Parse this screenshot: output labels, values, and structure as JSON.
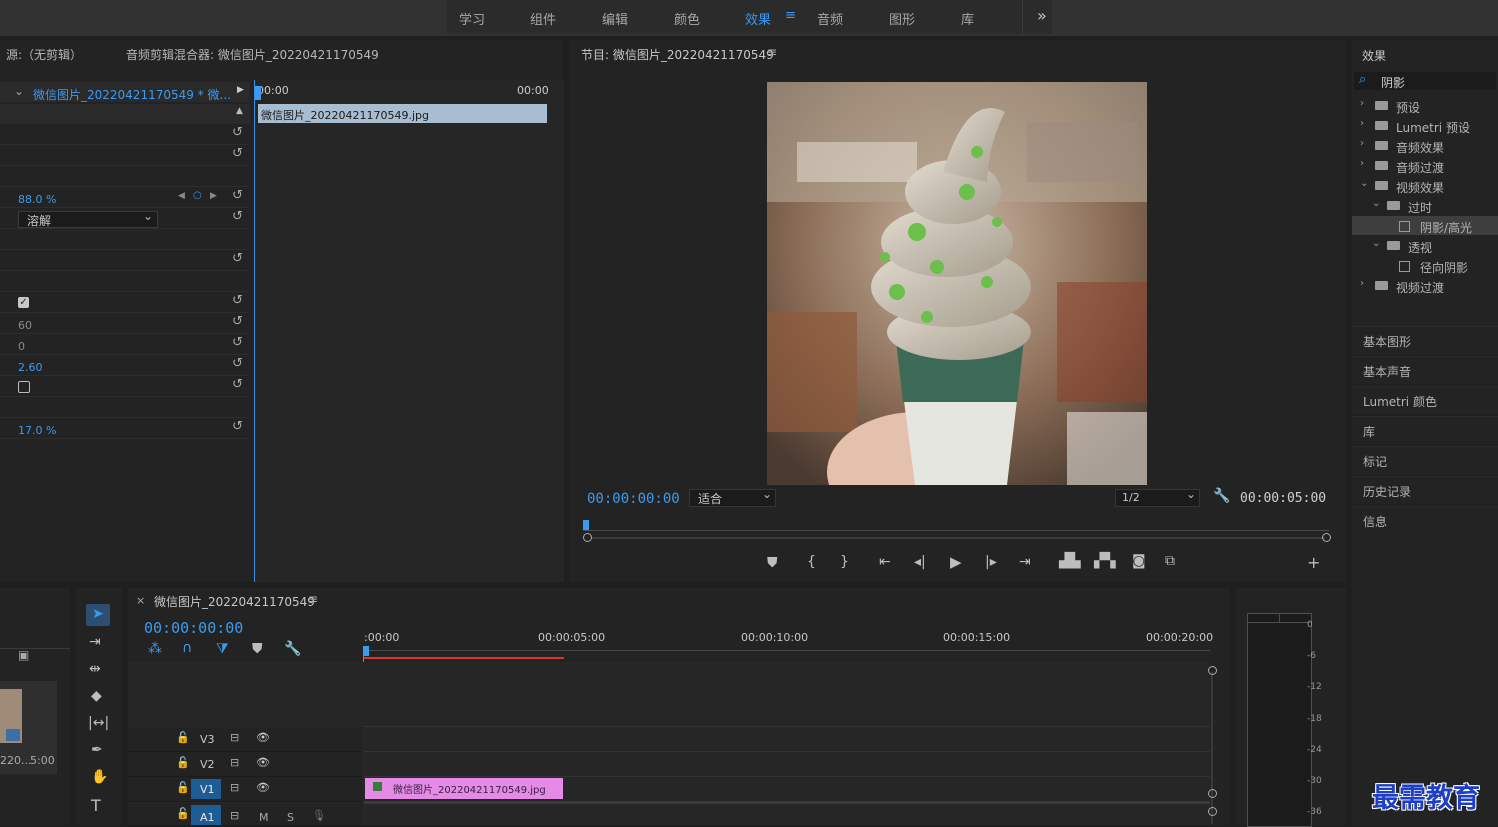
{
  "workspaces": [
    "学习",
    "组件",
    "编辑",
    "颜色",
    "效果",
    "音频",
    "图形",
    "库"
  ],
  "workspace_active_index": 4,
  "workspace_more": "»",
  "source": {
    "tab_source": "源:（无剪辑）",
    "tab_mixer": "音频剪辑混合器: 微信图片_20220421170549",
    "clip_path": "微信图片_20220421170549 * 微...",
    "time_start": "00:00",
    "time_end": "00:00",
    "clip_name": "微信图片_20220421170549.jpg",
    "values": [
      "88.0 %",
      "溶解",
      "60",
      "0",
      "2.60",
      "17.0 %"
    ]
  },
  "program": {
    "title": "节目: 微信图片_20220421170549",
    "timecode": "00:00:00:00",
    "fit": "适合",
    "resolution": "1/2",
    "duration": "00:00:05:00"
  },
  "effects": {
    "title": "效果",
    "search": "阴影",
    "tree": [
      {
        "label": "预设",
        "level": 0,
        "kind": "folder",
        "expanded": false
      },
      {
        "label": "Lumetri 预设",
        "level": 0,
        "kind": "folder",
        "expanded": false
      },
      {
        "label": "音频效果",
        "level": 0,
        "kind": "folder",
        "expanded": false
      },
      {
        "label": "音频过渡",
        "level": 0,
        "kind": "folder",
        "expanded": false
      },
      {
        "label": "视频效果",
        "level": 0,
        "kind": "folder",
        "expanded": true
      },
      {
        "label": "过时",
        "level": 1,
        "kind": "folder",
        "expanded": true
      },
      {
        "label": "阴影/高光",
        "level": 2,
        "kind": "effect",
        "selected": true
      },
      {
        "label": "透视",
        "level": 1,
        "kind": "folder",
        "expanded": true
      },
      {
        "label": "径向阴影",
        "level": 2,
        "kind": "effect"
      },
      {
        "label": "视频过渡",
        "level": 0,
        "kind": "folder",
        "expanded": false
      }
    ]
  },
  "side_panels": [
    "基本图形",
    "基本声音",
    "Lumetri 颜色",
    "库",
    "标记",
    "历史记录",
    "信息"
  ],
  "project": {
    "thumb_name": "220...",
    "thumb_dur": "5:00"
  },
  "timeline": {
    "tab": "微信图片_20220421170549",
    "timecode": "00:00:00:00",
    "ruler": [
      ":00:00",
      "00:00:05:00",
      "00:00:10:00",
      "00:00:15:00",
      "00:00:20:00"
    ],
    "tracks": [
      "V3",
      "V2",
      "V1",
      "A1"
    ],
    "track_m": "M",
    "track_s": "S",
    "clip": "微信图片_20220421170549.jpg"
  },
  "meter_scale": [
    "0",
    "-6",
    "-12",
    "-18",
    "-24",
    "-30",
    "-36"
  ],
  "watermark": "最需教育",
  "colors": {
    "accent": "#3c9bf0",
    "clip_pink": "#e58be6",
    "playhead_red": "#e0312a"
  }
}
